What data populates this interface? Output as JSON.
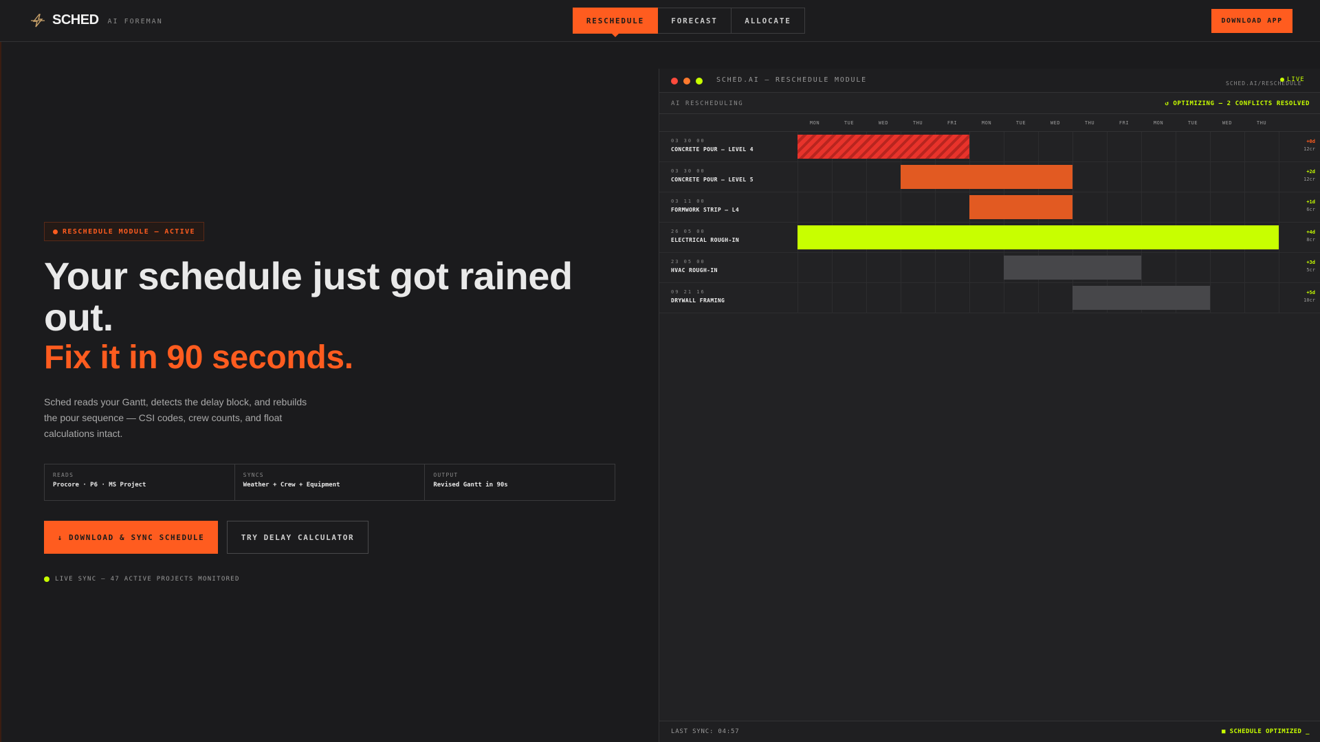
{
  "brand": {
    "name": "SCHED",
    "subtitle": "AI FOREMAN",
    "icon": "lightning-bolt-icon"
  },
  "nav": {
    "tabs": [
      {
        "label": "RESCHEDULE",
        "active": true
      },
      {
        "label": "FORECAST",
        "active": false
      },
      {
        "label": "ALLOCATE",
        "active": false
      }
    ],
    "download_label": "DOWNLOAD APP"
  },
  "hero": {
    "badge": "RESCHEDULE MODULE — ACTIVE",
    "headline": "Your schedule just got rained out.",
    "accent": "Fix it in 90 seconds.",
    "description": "Sched reads your Gantt, detects the delay block, and rebuilds the pour sequence — CSI codes, crew counts, and float calculations intact.",
    "specs": [
      {
        "label": "READS",
        "value": "Procore · P6 · MS Project"
      },
      {
        "label": "SYNCS",
        "value": "Weather + Crew + Equipment"
      },
      {
        "label": "OUTPUT",
        "value": "Revised Gantt in 90s"
      }
    ],
    "cta_primary": "↓ DOWNLOAD & SYNC SCHEDULE",
    "cta_secondary": "TRY DELAY CALCULATOR",
    "live_sync": "LIVE SYNC — 47 ACTIVE PROJECTS MONITORED"
  },
  "app": {
    "title": "SCHED.AI — RESCHEDULE MODULE",
    "live": "LIVE",
    "url": "SCHED.AI/RESCHEDULE",
    "section_label": "AI RESCHEDULING",
    "status": "↺ OPTIMIZING — 2 CONFLICTS RESOLVED",
    "days": [
      "MON",
      "TUE",
      "WED",
      "THU",
      "FRI",
      "MON",
      "TUE",
      "WED",
      "THU",
      "FRI",
      "MON",
      "TUE",
      "WED",
      "THU"
    ],
    "tasks": [
      {
        "code": "03 30 00",
        "name": "CONCRETE POUR — LEVEL 4",
        "delta": "+0d",
        "crew": "12cr",
        "start": 0,
        "span": 5,
        "kind": "delay"
      },
      {
        "code": "03 30 00",
        "name": "CONCRETE POUR — LEVEL 5",
        "delta": "+2d",
        "crew": "12cr",
        "start": 3,
        "span": 5,
        "kind": "shifted"
      },
      {
        "code": "03 11 00",
        "name": "FORMWORK STRIP — L4",
        "delta": "+1d",
        "crew": "6cr",
        "start": 5,
        "span": 3,
        "kind": "shifted"
      },
      {
        "code": "26 05 00",
        "name": "ELECTRICAL ROUGH-IN",
        "delta": "+4d",
        "crew": "8cr",
        "start": 0,
        "span": 14,
        "kind": "critical"
      },
      {
        "code": "23 05 00",
        "name": "HVAC ROUGH-IN",
        "delta": "+3d",
        "crew": "5cr",
        "start": 6,
        "span": 4,
        "kind": "pending"
      },
      {
        "code": "09 21 16",
        "name": "DRYWALL FRAMING",
        "delta": "+5d",
        "crew": "10cr",
        "start": 8,
        "span": 4,
        "kind": "pending"
      }
    ],
    "last_sync": "LAST SYNC: 04:57",
    "footer_status": "■ SCHEDULE OPTIMIZED _"
  },
  "colors": {
    "accent": "#ff5c1f",
    "lime": "#c8ff00",
    "delay": "#e8332b",
    "shifted": "#e25a22",
    "pending": "#47474a",
    "delta_red": "#ff5c1f",
    "delta_lime": "#c8ff00"
  }
}
